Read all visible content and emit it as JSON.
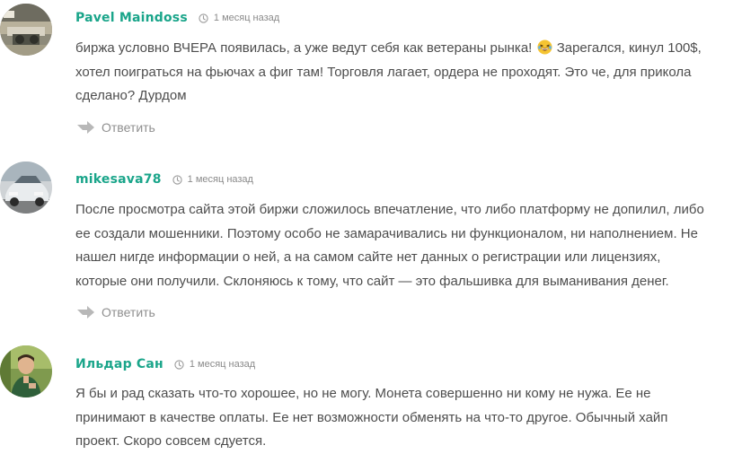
{
  "comments": [
    {
      "author": "Pavel Maindoss",
      "date": "1 месяц назад",
      "lines": [
        "биржа условно ВЧЕРА появилась, а уже ведут себя как ветераны рынка!",
        "Зарегался, кинул 100$,",
        "хотел поиграться на фьючах а фиг там! Торговля лагает, ордера не проходят. Это че, для прикола",
        "сделано? Дурдом"
      ],
      "emoji_icon": "laughing-emoji-icon",
      "reply": "Ответить"
    },
    {
      "author": "mikesava78",
      "date": "1 месяц назад",
      "lines": [
        "После просмотра сайта этой биржи сложилось впечатление, что либо платформу не допилил, либо",
        "ее создали мошенники. Поэтому особо не замарачивались ни функционалом, ни наполнением. Не",
        "нашел нигде информации о ней, а на самом сайте нет данных о регистрации или лицензиях,",
        "которые они получили. Склоняюсь к тому, что сайт — это фальшивка для выманивания денег."
      ],
      "reply": "Ответить"
    },
    {
      "author": "Ильдар Сан",
      "date": "1 месяц назад",
      "lines": [
        "Я бы и рад сказать что-то хорошее, но не могу. Монета совершенно ни кому не нужа. Ее не",
        "принимают в качестве оплаты. Ее нет возможности обменять на что-то другое. Обычный хайп",
        "проект. Скоро совсем сдуется."
      ]
    }
  ],
  "colors": {
    "author": "#1aa58a",
    "text": "#4d4d4d",
    "meta": "#8a8a8a"
  },
  "icons": {
    "clock": "clock-icon",
    "reply": "reply-arrow-icon"
  }
}
